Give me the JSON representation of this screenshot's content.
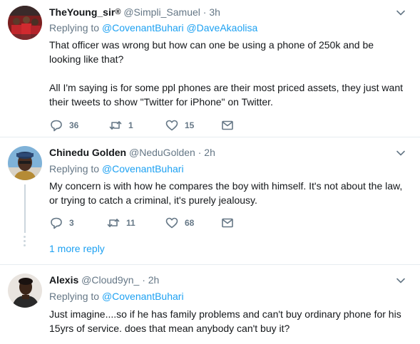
{
  "tweets": [
    {
      "display_name": "TheYoung_sir",
      "badge": "®",
      "handle": "@Simpli_Samuel",
      "dot": "·",
      "time": "3h",
      "replying_prefix": "Replying to",
      "mentions": [
        "@CovenantBuhari",
        "@DaveAkaolisa"
      ],
      "text_paragraphs": [
        "That officer was wrong but how can one be using a phone of 250k and be looking like that?",
        "All I'm saying is for some ppl phones are their most priced assets, they just want their tweets to show \"Twitter for iPhone\" on Twitter."
      ],
      "reply_count": "36",
      "retweet_count": "1",
      "like_count": "15"
    },
    {
      "display_name": "Chinedu Golden",
      "handle": "@NeduGolden",
      "dot": "·",
      "time": "2h",
      "replying_prefix": "Replying to",
      "mentions": [
        "@CovenantBuhari"
      ],
      "text_paragraphs": [
        "My concern is with how he compares the boy with himself. It's not about the law, or trying to catch a criminal, it's purely jealousy."
      ],
      "reply_count": "3",
      "retweet_count": "11",
      "like_count": "68",
      "more_replies": "1 more reply"
    },
    {
      "display_name": "Alexis",
      "handle": "@Cloud9yn_",
      "dot": "·",
      "time": "2h",
      "replying_prefix": "Replying to",
      "mentions": [
        "@CovenantBuhari"
      ],
      "text_paragraphs": [
        "Just imagine....so if he has family problems and can't buy ordinary phone  for his 15yrs of service. does that mean anybody can't buy it?"
      ]
    }
  ],
  "icons": {
    "reply": "reply-icon",
    "retweet": "retweet-icon",
    "like": "heart-icon",
    "dm": "envelope-icon",
    "caret": "chevron-down-icon"
  },
  "colors": {
    "link": "#1da1f2",
    "muted": "#657786",
    "text": "#14171a",
    "divider": "#e6ecf0",
    "thread": "#ccd6dd"
  }
}
